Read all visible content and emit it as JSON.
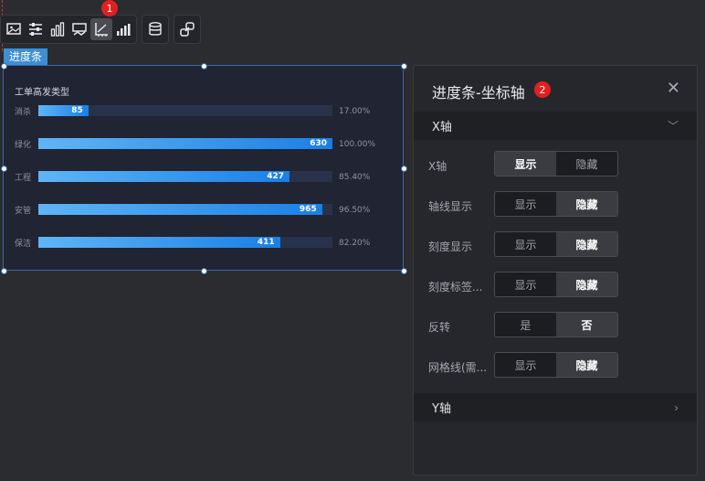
{
  "toolbar": {
    "badge": "1",
    "icons": [
      "image-icon",
      "sliders-icon",
      "bar-chart-icon",
      "map-icon",
      "axis-icon",
      "bar-series-icon",
      "database-icon",
      "link-icon"
    ]
  },
  "component_tag": "进度条",
  "chart_data": {
    "type": "bar",
    "title": "工单高发类型",
    "categories": [
      "消杀",
      "绿化",
      "工程",
      "安管",
      "保洁"
    ],
    "values": [
      85,
      630,
      427,
      965,
      411
    ],
    "percent_labels": [
      "17.00%",
      "100.00%",
      "85.40%",
      "96.50%",
      "82.20%"
    ],
    "percentages": [
      17.0,
      100.0,
      85.4,
      96.5,
      82.2
    ],
    "bar_gradient": [
      "#5fb5f5",
      "#1a7fe6"
    ],
    "track_color": "#28324a"
  },
  "panel": {
    "title": "进度条-坐标轴",
    "badge": "2",
    "close_icon": "close-icon",
    "x_section": "X轴",
    "y_section": "Y轴",
    "rows": [
      {
        "label": "X轴",
        "options": [
          "显示",
          "隐藏"
        ],
        "selected": 0
      },
      {
        "label": "轴线显示",
        "options": [
          "显示",
          "隐藏"
        ],
        "selected": 1
      },
      {
        "label": "刻度显示",
        "options": [
          "显示",
          "隐藏"
        ],
        "selected": 1
      },
      {
        "label": "刻度标签...",
        "options": [
          "显示",
          "隐藏"
        ],
        "selected": 1
      },
      {
        "label": "反转",
        "options": [
          "是",
          "否"
        ],
        "selected": 1
      },
      {
        "label": "网格线(需...",
        "options": [
          "显示",
          "隐藏"
        ],
        "selected": 1
      }
    ]
  },
  "colors": {
    "accent": "#3d8fd4",
    "badge": "#e02020"
  }
}
